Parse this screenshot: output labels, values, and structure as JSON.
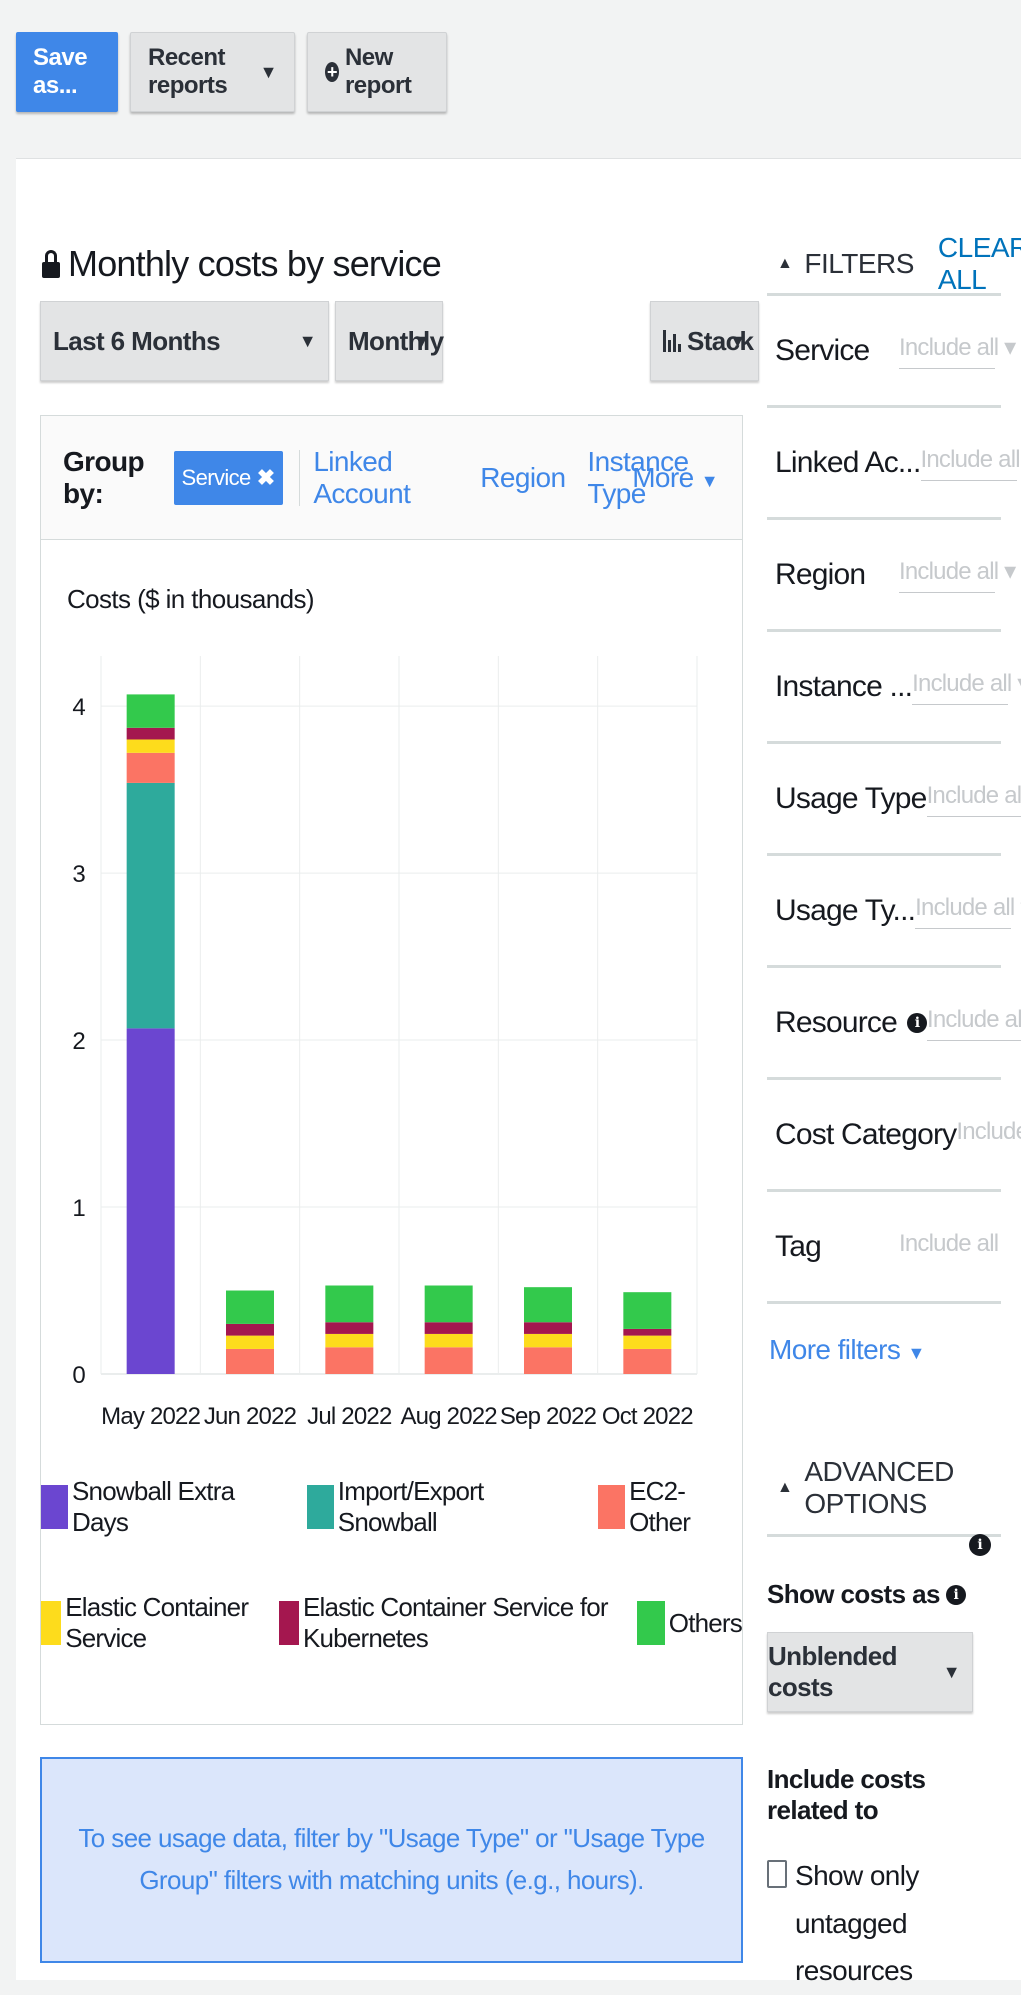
{
  "toolbar": {
    "save_as": "Save as...",
    "recent_reports": "Recent reports",
    "new_report": "New report"
  },
  "report": {
    "title": "Monthly costs by service",
    "time_range": "Last 6 Months",
    "granularity": "Monthly",
    "chart_style": "Stack"
  },
  "group_by": {
    "label": "Group by:",
    "active": "Service",
    "options": [
      "Linked Account",
      "Region",
      "Instance Type"
    ],
    "more": "More"
  },
  "filters": {
    "header": "FILTERS",
    "clear_all": "CLEAR ALL",
    "items": [
      {
        "name": "Service",
        "value": "Include all"
      },
      {
        "name": "Linked Ac...",
        "value": "Include all"
      },
      {
        "name": "Region",
        "value": "Include all"
      },
      {
        "name": "Instance ...",
        "value": "Include all"
      },
      {
        "name": "Usage Type",
        "value": "Include all"
      },
      {
        "name": "Usage Ty...",
        "value": "Include all"
      },
      {
        "name": "Resource",
        "value": "Include all"
      },
      {
        "name": "Cost Category",
        "value": "Include all"
      },
      {
        "name": "Tag",
        "value": "Include all"
      }
    ],
    "more_filters": "More filters"
  },
  "advanced": {
    "header": "ADVANCED OPTIONS",
    "show_costs_as_label": "Show costs as",
    "show_costs_as_value": "Unblended costs",
    "include_label": "Include costs related to",
    "untagged_label": "Show only untagged resources",
    "untagged_checked": false
  },
  "info_message": "To see usage data, filter by \"Usage Type\" or \"Usage Type Group\" filters with matching units (e.g., hours).",
  "chart_data": {
    "type": "bar",
    "stacked": true,
    "ylabel": "Costs ($ in thousands)",
    "ylim": [
      0,
      4.3
    ],
    "yticks": [
      0,
      1,
      2,
      3,
      4
    ],
    "grid": true,
    "legend_position": "bottom",
    "categories": [
      "May 2022",
      "Jun 2022",
      "Jul 2022",
      "Aug 2022",
      "Sep 2022",
      "Oct 2022"
    ],
    "series": [
      {
        "name": "Snowball Extra Days",
        "color": "#6b46d0",
        "values": [
          2.07,
          0,
          0,
          0,
          0,
          0
        ]
      },
      {
        "name": "Import/Export Snowball",
        "color": "#2eaa9c",
        "values": [
          1.47,
          0,
          0,
          0,
          0,
          0
        ]
      },
      {
        "name": "EC2-Other",
        "color": "#fb7464",
        "values": [
          0.18,
          0.15,
          0.16,
          0.16,
          0.16,
          0.15
        ]
      },
      {
        "name": "Elastic Container Service",
        "color": "#fddc1c",
        "values": [
          0.08,
          0.08,
          0.08,
          0.08,
          0.08,
          0.08
        ]
      },
      {
        "name": "Elastic Container Service for Kubernetes",
        "color": "#a4174f",
        "values": [
          0.07,
          0.07,
          0.07,
          0.07,
          0.07,
          0.04
        ]
      },
      {
        "name": "Others",
        "color": "#33c94c",
        "values": [
          0.2,
          0.2,
          0.22,
          0.22,
          0.21,
          0.22
        ]
      }
    ]
  }
}
